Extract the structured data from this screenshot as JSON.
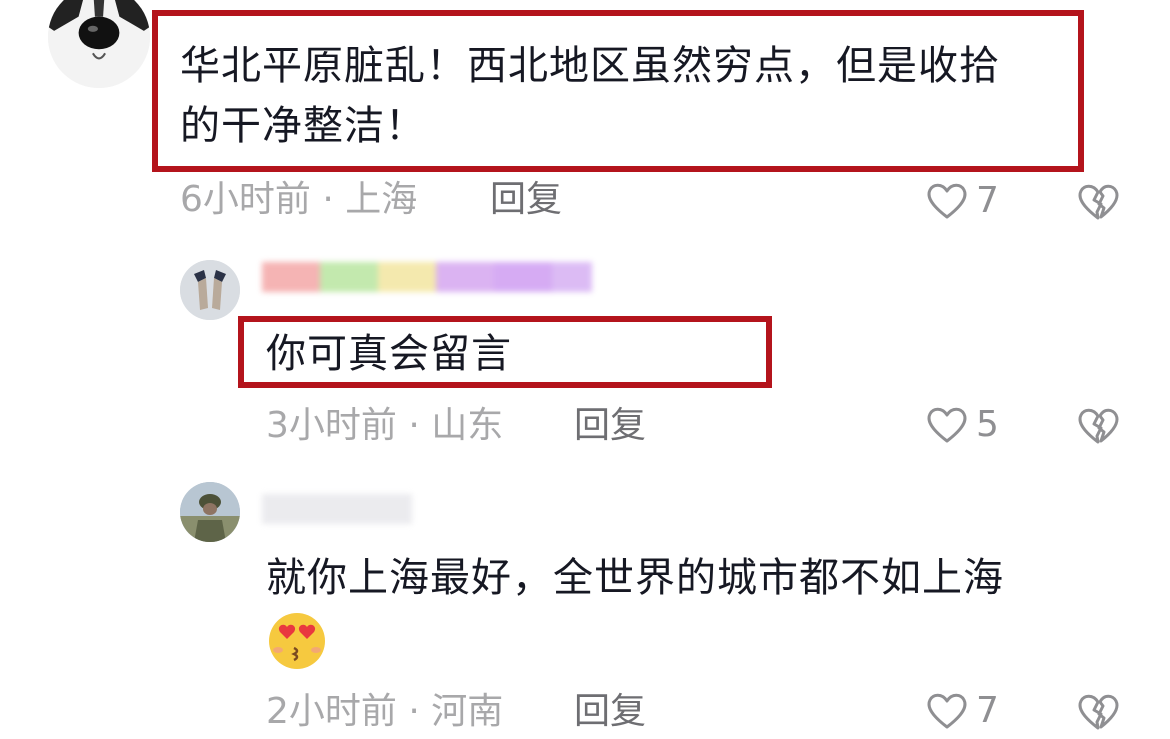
{
  "comments": [
    {
      "text_line1": "华北平原脏乱！西北地区虽然穷点，但是收拾",
      "text_line2": "的干净整洁！",
      "time": "6小时前",
      "location": "上海",
      "meta": "6小时前 · 上海",
      "reply_label": "回复",
      "likes": "7",
      "highlighted": true
    },
    {
      "text_line1": "你可真会留言",
      "time": "3小时前",
      "location": "山东",
      "meta": "3小时前 · 山东",
      "reply_label": "回复",
      "likes": "5",
      "highlighted": true
    },
    {
      "text_line1": "就你上海最好，全世界的城市都不如上海",
      "emoji": "heart-eyes-kiss",
      "time": "2小时前",
      "location": "河南",
      "meta": "2小时前 · 河南",
      "reply_label": "回复",
      "likes": "7",
      "highlighted": false
    }
  ],
  "colors": {
    "highlight_border": "#b4141c",
    "text": "#161823",
    "meta": "#a8a8aa",
    "reply": "#6e6e72"
  },
  "icons": {
    "like": "heart-outline-icon",
    "dislike": "broken-heart-icon"
  }
}
